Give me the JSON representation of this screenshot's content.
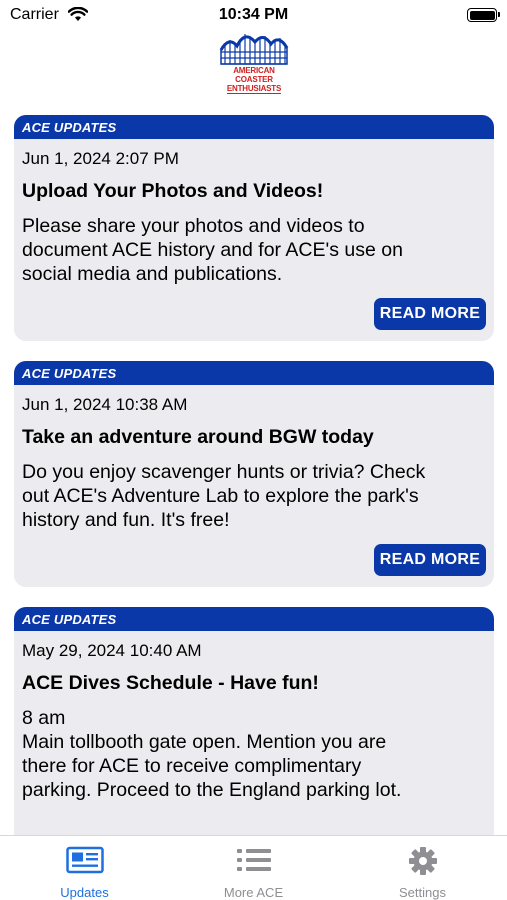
{
  "status_bar": {
    "carrier": "Carrier",
    "time": "10:34 PM"
  },
  "logo": {
    "line1": "AMERICAN",
    "line2": "COASTER",
    "line3": "ENTHUSIASTS",
    "color": "#d0201f",
    "accent": "#0b38a8"
  },
  "cards": [
    {
      "category": "ACE UPDATES",
      "date": "Jun 1, 2024 2:07 PM",
      "title": "Upload Your Photos and Videos!",
      "text": "Please share your photos and videos to\ndocument ACE history and for ACE's use on\nsocial media and publications.",
      "button": "READ MORE"
    },
    {
      "category": "ACE UPDATES",
      "date": "Jun 1, 2024 10:38 AM",
      "title": "Take an adventure around BGW today",
      "text": "Do you enjoy scavenger hunts or trivia? Check\nout ACE's Adventure Lab to explore the park's\nhistory and fun. It's free!",
      "button": "READ MORE"
    },
    {
      "category": "ACE UPDATES",
      "date": "May 29, 2024 10:40 AM",
      "title": "ACE Dives Schedule - Have fun!",
      "text": "8 am\nMain tollbooth gate open. Mention you are\nthere for ACE to receive complimentary\nparking. Proceed to the England parking lot."
    }
  ],
  "tabs": [
    {
      "label": "Updates",
      "icon": "newspaper-icon",
      "active": true
    },
    {
      "label": "More ACE",
      "icon": "list-icon",
      "active": false
    },
    {
      "label": "Settings",
      "icon": "gear-icon",
      "active": false
    }
  ],
  "colors": {
    "primary": "#0b38a8",
    "card_background": "#ececf0",
    "tab_active": "#1f6fe0",
    "tab_inactive": "#8e8e93"
  }
}
